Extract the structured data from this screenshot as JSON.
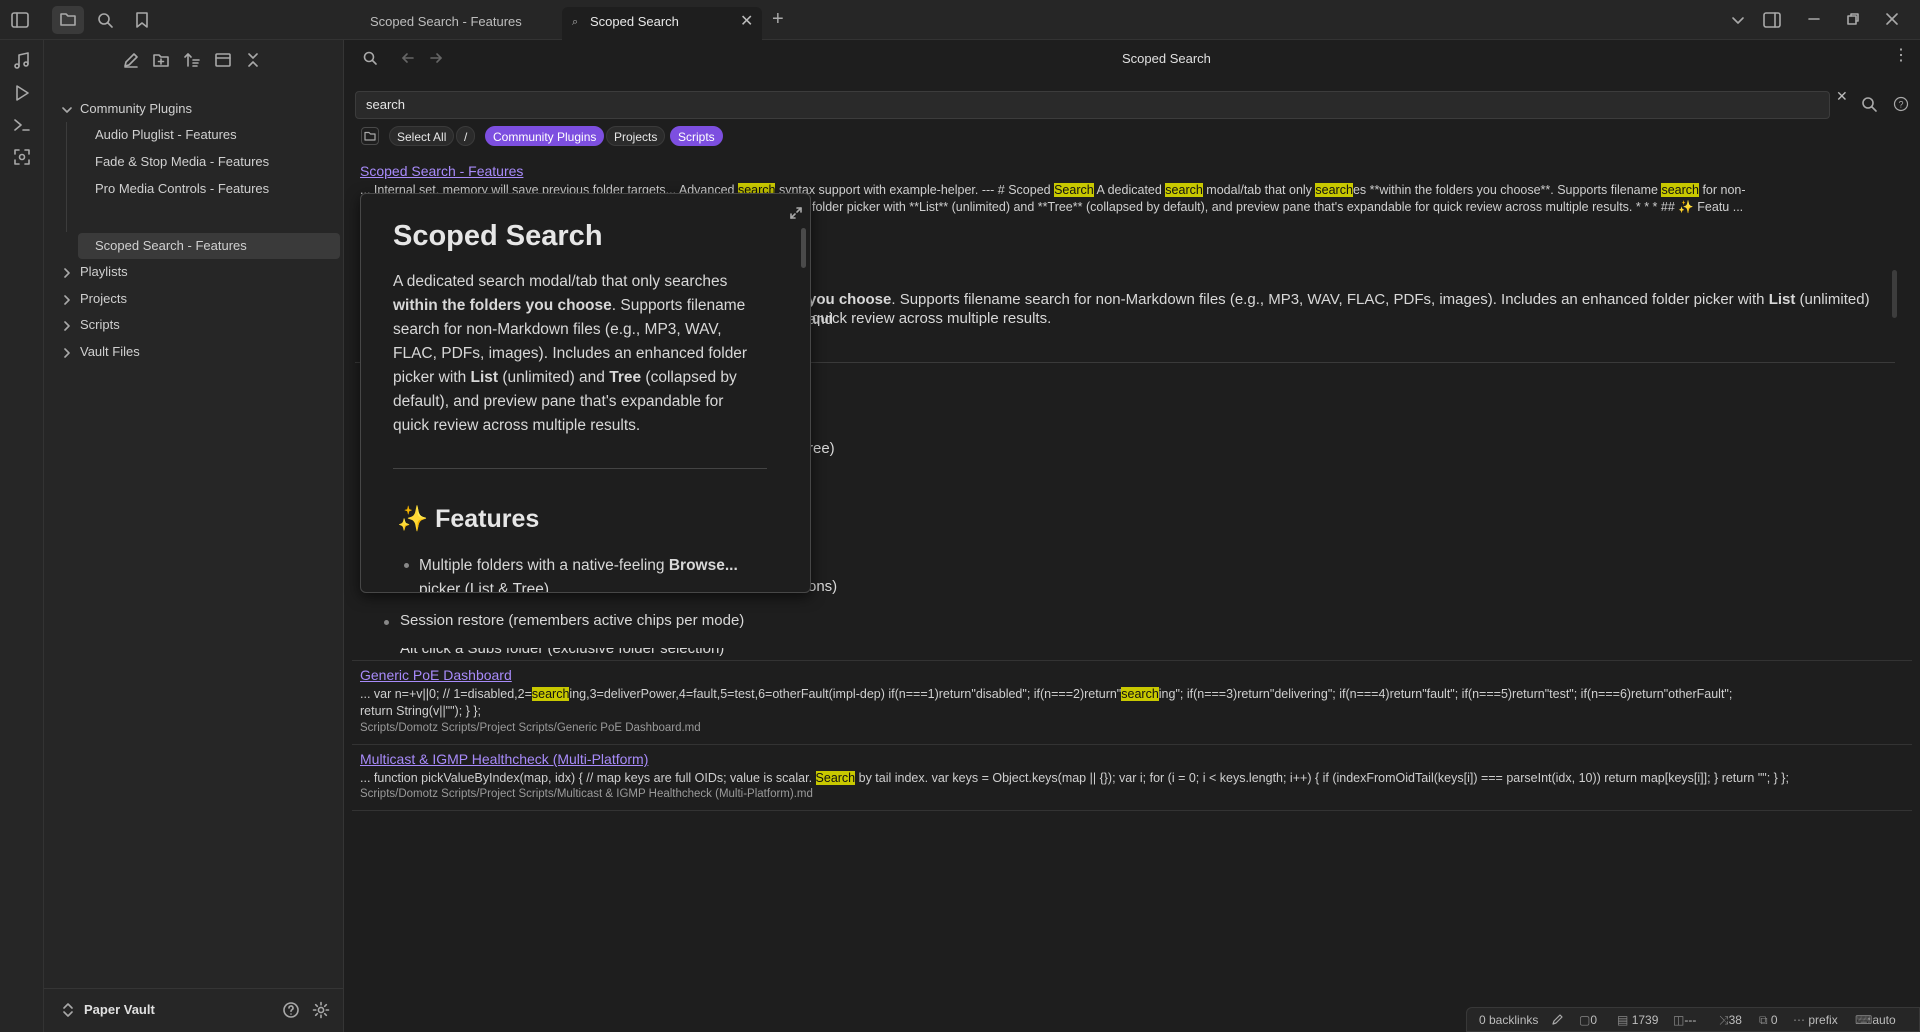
{
  "tabs": [
    {
      "label": "Scoped Search - Features"
    },
    {
      "label": "Scoped Search"
    }
  ],
  "sidebar": {
    "tree": [
      {
        "label": "Community Plugins",
        "expanded": true
      },
      {
        "label": "Audio Pluglist - Features"
      },
      {
        "label": "Fade & Stop Media - Features"
      },
      {
        "label": "Pro Media Controls - Features"
      },
      {
        "label": "Scoped Search - Features",
        "selected": true
      },
      {
        "label": "Playlists"
      },
      {
        "label": "Projects"
      },
      {
        "label": "Scripts"
      },
      {
        "label": "Vault Files"
      }
    ],
    "vault_name": "Paper Vault"
  },
  "view": {
    "title": "Scoped Search",
    "search_value": "search"
  },
  "chips": {
    "select_all": "Select All",
    "slash": "/",
    "items": [
      {
        "label": "Community Plugins",
        "active": true
      },
      {
        "label": "Projects",
        "active": false
      },
      {
        "label": "Scripts",
        "active": true
      }
    ]
  },
  "results": {
    "r1": {
      "title": "Scoped Search - Features",
      "s1": "... Internal set, memory will save previous folder targets... Advanced ",
      "s1h": "search",
      "s2": " syntax support with example-helper. --- # Scoped ",
      "s2h": "Search",
      "s3": " A dedicated ",
      "s3h": "search",
      "s4": " modal/tab that only ",
      "s4h": "search",
      "s5": "es **within the folders you choose**. Supports filename ",
      "s5h": "search",
      "s6": " for non-",
      "line2": "folder picker with **List** (unlimited) and **Tree** (collapsed by default), and preview pane that's expandable for quick review across multiple results. * * * ## ✨ Featu ...",
      "doc_a": "you choose",
      "doc_b": ". Supports filename search for non-Markdown files (e.g., MP3, WAV, FLAC, PDFs, images). Includes an enhanced folder picker with ",
      "doc_c": "List",
      "doc_d": " (unlimited) and",
      "doc_line2": "quick review across multiple results.",
      "frag_tree": "ree)",
      "frag_ons": "ons)",
      "bullet_session": "Session restore (remembers active chips per mode)",
      "bullet_alt": "Alt click a Subs folder (exclusive folder selection)"
    },
    "r2": {
      "title": "Generic PoE Dashboard",
      "a": "... var n=+v||0; // 1=disabled,2=",
      "ah": "search",
      "b": "ing,3=deliverPower,4=fault,5=test,6=otherFault(impl-dep) if(n===1)return\"disabled\"; if(n===2)return\"",
      "bh": "search",
      "c": "ing\"; if(n===3)return\"delivering\"; if(n===4)return\"fault\"; if(n===5)return\"test\"; if(n===6)return\"otherFault\";",
      "d": "return String(v||\"\"); } };",
      "path": "Scripts/Domotz Scripts/Project Scripts/Generic PoE Dashboard.md"
    },
    "r3": {
      "title": "Multicast & IGMP Healthcheck (Multi-Platform)",
      "a": "... function pickValueByIndex(map, idx) { // map keys are full OIDs; value is scalar. ",
      "ah": "Search",
      "b": " by tail index. var keys = Object.keys(map || {}); var i; for (i = 0; i < keys.length; i++) { if (indexFromOidTail(keys[i]) === parseInt(idx, 10)) return map[keys[i]]; } return \"\"; } };",
      "path": "Scripts/Domotz Scripts/Project Scripts/Multicast & IGMP Healthcheck (Multi-Platform).md"
    }
  },
  "preview": {
    "heading": "Scoped Search",
    "p1": "A dedicated search modal/tab that only searches ",
    "p1b": "within the folders you choose",
    "p2": ". Supports filename search for non-Markdown files (e.g., MP3, WAV, FLAC, PDFs, images). Includes an enhanced folder picker with ",
    "p2b": "List",
    "p3": " (unlimited) and ",
    "p3b": "Tree",
    "p4": " (collapsed by default), and preview pane that's expandable for quick review across multiple results.",
    "features_heading": "Features",
    "features_emoji": "✨",
    "bullet1a": "Multiple folders with a native-feeling ",
    "bullet1b": "Browse...",
    "bullet1c": " picker (List & Tree)"
  },
  "status": {
    "backlinks": "0 backlinks",
    "s1": "0",
    "words": "1739",
    "s3": "---",
    "s4": "38",
    "s5": "0",
    "prefix": "prefix",
    "auto": "auto"
  },
  "colors": {
    "accent": "#7d4fe0",
    "link": "#a88bfa",
    "highlight": "#c8c800"
  }
}
